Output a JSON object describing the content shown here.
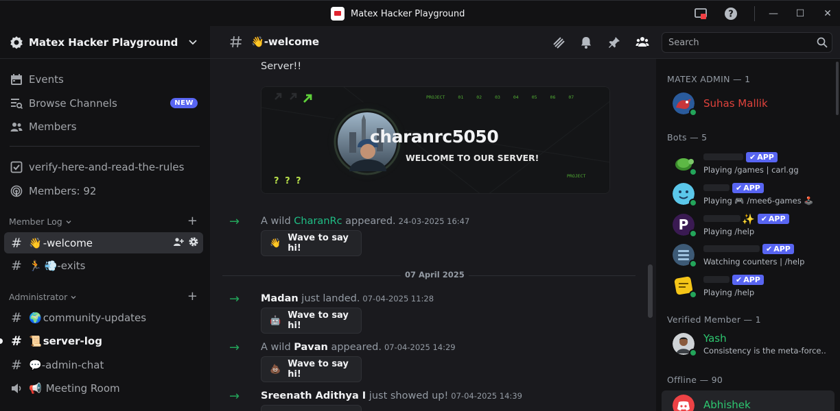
{
  "window": {
    "title": "Matex Hacker Playground",
    "controls": [
      "—",
      "☐",
      "✕"
    ]
  },
  "sidebar": {
    "server_name": "Matex Hacker Playground",
    "top_items": [
      {
        "label": "Events",
        "icon": "calendar-icon"
      },
      {
        "label": "Browse Channels",
        "icon": "browse-channels-icon",
        "badge": "NEW"
      },
      {
        "label": "Members",
        "icon": "members-icon"
      }
    ],
    "channels_top": [
      {
        "label": "verify-here-and-read-the-rules",
        "icon": "checkbox-icon"
      },
      {
        "label": "Members: 92",
        "icon": "stage-icon"
      }
    ],
    "categories": [
      {
        "label": "Member Log",
        "channels": [
          {
            "emoji": "👋",
            "label": "-welcome",
            "active": true
          },
          {
            "emoji": "🏃",
            "label": "💨-exits"
          }
        ]
      },
      {
        "label": "Administrator",
        "channels": [
          {
            "emoji": "🌍",
            "label": "community-updates"
          },
          {
            "emoji": "📜",
            "label": "server-log",
            "unread": true
          },
          {
            "emoji": "💬",
            "label": "-admin-chat"
          },
          {
            "emoji": "📢",
            "label": "Meeting Room",
            "voice": true
          }
        ]
      }
    ]
  },
  "header": {
    "channel_emoji": "👋",
    "channel_name": "-welcome",
    "search_placeholder": "Search"
  },
  "messages": {
    "top_text": "Server!!",
    "banner": {
      "username": "charanrc5050",
      "tagline": "WELCOME TO OUR SERVER!",
      "project_label": "PROJECT",
      "project_numbers": [
        "01",
        "02",
        "03",
        "04",
        "05",
        "06",
        "07"
      ],
      "question_marks": "? ? ?"
    },
    "system": [
      {
        "prefix": "A wild ",
        "user": "CharanRc",
        "suffix": " appeared.",
        "time": "24-03-2025 16:47",
        "wave": "Wave to say hi!",
        "green": true
      },
      {
        "prefix": "",
        "user": "Madan",
        "suffix": " just landed.",
        "time": "07-04-2025 11:28",
        "wave": "Wave to say hi!"
      },
      {
        "prefix": "A wild ",
        "user": "Pavan",
        "suffix": " appeared.",
        "time": "07-04-2025 14:29",
        "wave": "Wave to say hi!"
      },
      {
        "prefix": "",
        "user": "Sreenath Adithya I",
        "suffix": " just showed up!",
        "time": "07-04-2025 14:39"
      }
    ],
    "date_divider": "07 April 2025"
  },
  "members": {
    "sections": [
      {
        "title": "MATEX ADMIN — 1"
      },
      {
        "title": "Bots — 5"
      },
      {
        "title": "Verified Member — 1"
      },
      {
        "title": "Offline — 90"
      }
    ],
    "admin": {
      "name": "Suhas Mallik",
      "color": "#e0423c"
    },
    "bots": [
      {
        "activity": "Playing /games | carl.gg",
        "badge": "APP"
      },
      {
        "activity": "Playing 🎮 /mee6-games 🕹️",
        "badge": "APP"
      },
      {
        "activity": "Playing /help",
        "badge": "APP",
        "sparkle": "✨"
      },
      {
        "activity": "Watching counters | /help",
        "badge": "APP"
      },
      {
        "activity": "Playing /help",
        "badge": "APP"
      }
    ],
    "verified": {
      "name": "Yash",
      "status": "Consistency is the meta-force...",
      "color": "#2dc770"
    },
    "offline": [
      {
        "name": "Abhishek",
        "color": "#2dc770"
      }
    ]
  }
}
